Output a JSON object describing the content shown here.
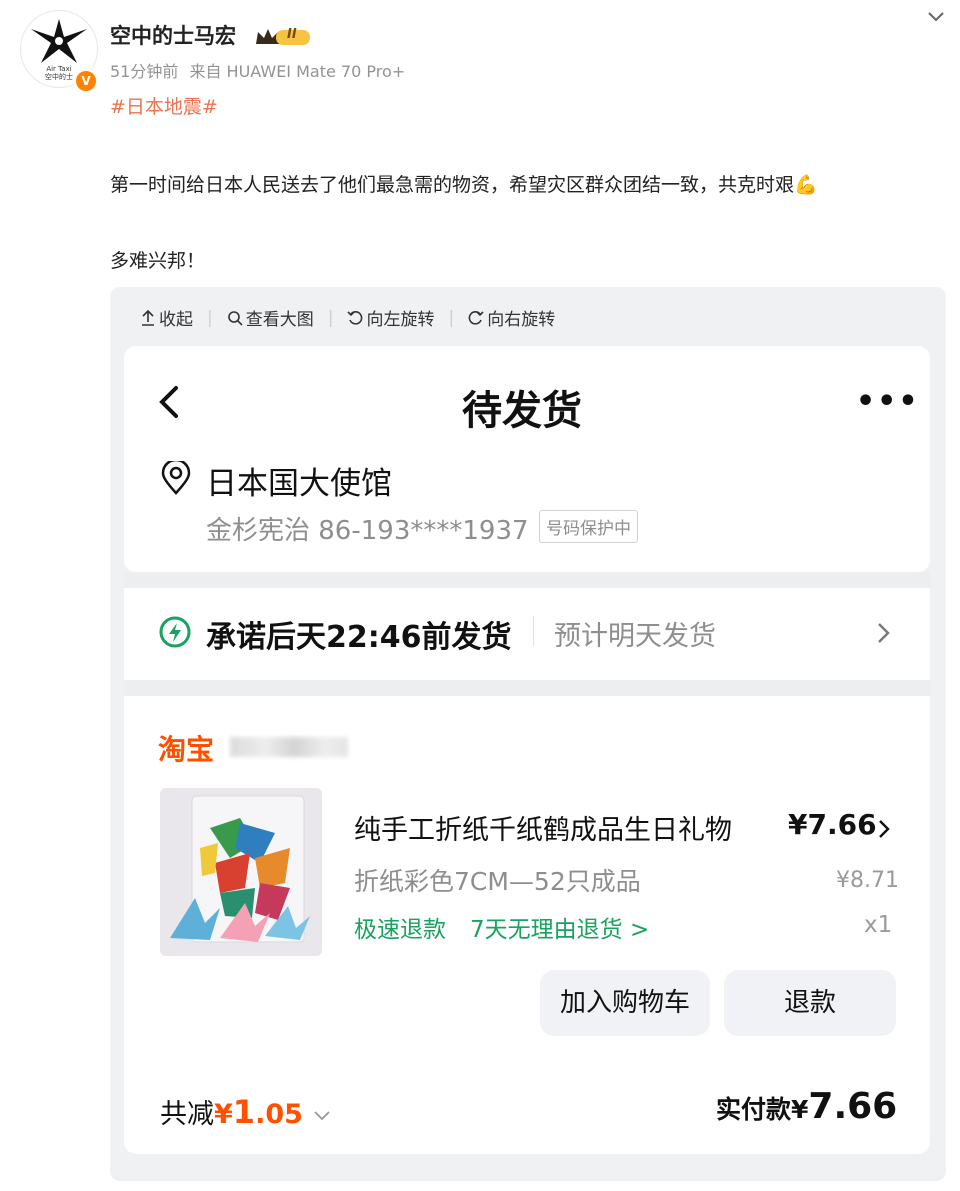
{
  "post": {
    "avatar_brand": "Air Taxi\n空中的士",
    "username": "空中的士马宏",
    "level_badge": "II",
    "time": "51分钟前",
    "source": "来自 HUAWEI Mate 70 Pro+",
    "hashtag": "#日本地震#",
    "text_line1": "第一时间给日本人民送去了他们最急需的物资，希望灾区群众团结一致，共克时艰💪",
    "text_line2": "多难兴邦！"
  },
  "toolbar": {
    "collapse": "收起",
    "view_large": "查看大图",
    "rotate_left": "向左旋转",
    "rotate_right": "向右旋转"
  },
  "order": {
    "nav_title": "待发货",
    "recipient_name": "日本国大使馆",
    "recipient_contact": "金杉宪治 86-193****1937",
    "privacy_label": "号码保护中",
    "ship_promise": "承诺后天22:46前发货",
    "ship_estimate": "预计明天发货",
    "shop_label": "淘宝",
    "product_title": "纯手工折纸千纸鹤成品生日礼物",
    "product_price": "¥7.66",
    "product_spec": "折纸彩色7CM—52只成品",
    "original_price": "¥8.71",
    "service_fast_refund": "极速退款",
    "service_return": "7天无理由退货 >",
    "quantity": "x1",
    "btn_add_cart": "加入购物车",
    "btn_refund": "退款",
    "discount_label": "共减",
    "discount_currency": "¥",
    "discount_int": "1",
    "discount_dec": ".05",
    "paid_label": "实付款¥",
    "paid_value": "7.66"
  },
  "colors": {
    "weibo_orange": "#ff8200",
    "hashtag": "#eb7350",
    "taobao_orange": "#ff5000",
    "service_green": "#1aa260"
  }
}
